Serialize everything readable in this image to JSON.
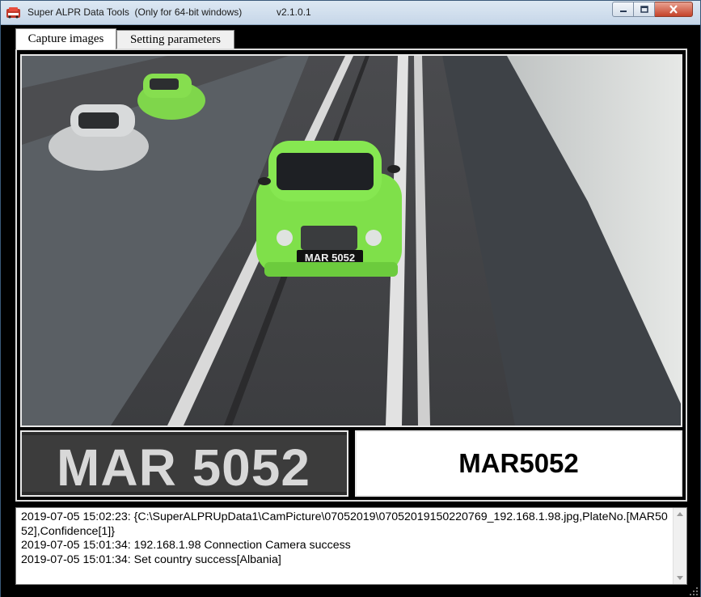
{
  "window": {
    "title": "Super ALPR Data Tools  (Only for 64-bit windows)",
    "version": "v2.1.0.1",
    "icon": "car-app-icon"
  },
  "controls": {
    "minimize_icon": "minimize-icon",
    "maximize_icon": "maximize-icon",
    "close_icon": "close-icon"
  },
  "tabs": [
    {
      "label": "Capture images",
      "active": true
    },
    {
      "label": "Setting parameters",
      "active": false
    }
  ],
  "capture": {
    "plate_in_image": "MAR 5052",
    "plate_crop_text": "MAR 5052",
    "recognized_plate": "MAR5052"
  },
  "log": {
    "lines": [
      "2019-07-05 15:02:23: {C:\\SuperALPRUpData1\\CamPicture\\07052019\\07052019150220769_192.168.1.98.jpg,PlateNo.[MAR5052],Confidence[1]}",
      "2019-07-05 15:01:34: 192.168.1.98 Connection Camera success",
      "2019-07-05 15:01:34: Set country success[Albania]"
    ]
  },
  "colors": {
    "car_green": "#7fe04a",
    "close_red": "#c5432a",
    "background": "#000000"
  }
}
